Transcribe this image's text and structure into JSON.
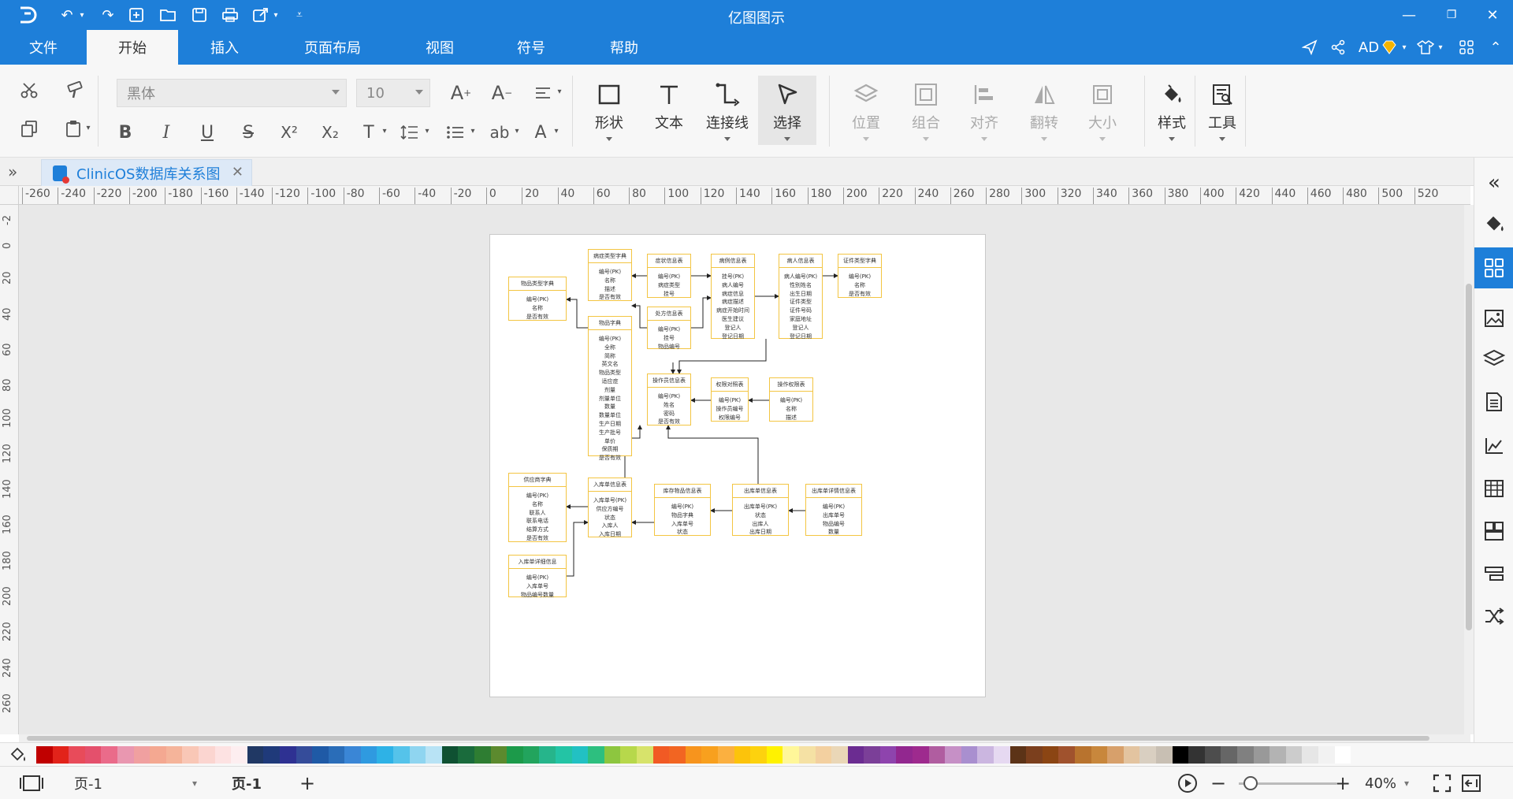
{
  "app": {
    "title": "亿图图示",
    "logo": "edraw-logo"
  },
  "quick_access": [
    "undo-icon",
    "redo-icon",
    "new-icon",
    "open-icon",
    "save-icon",
    "print-icon",
    "export-icon",
    "customize-icon"
  ],
  "menu": {
    "tabs": [
      "文件",
      "开始",
      "插入",
      "页面布局",
      "视图",
      "符号",
      "帮助"
    ],
    "active": "开始",
    "right": {
      "user": "AD"
    }
  },
  "ribbon": {
    "font_family": "黑体",
    "font_size": "10",
    "tools": {
      "shape": "形状",
      "text": "文本",
      "connector": "连接线",
      "select": "选择",
      "position": "位置",
      "group": "组合",
      "align": "对齐",
      "flip": "翻转",
      "size": "大小",
      "style": "样式",
      "tools": "工具"
    },
    "format_labels": {
      "bold": "B",
      "italic": "I",
      "underline": "U",
      "strike": "S",
      "superscript": "X²",
      "subscript": "X₂",
      "text": "T",
      "ab": "ab",
      "fontcolor": "A"
    }
  },
  "document": {
    "tab_name": "ClinicOS数据库关系图"
  },
  "rulers": {
    "h": [
      "-260",
      "-240",
      "-220",
      "-200",
      "-180",
      "-160",
      "-140",
      "-120",
      "-100",
      "-80",
      "-60",
      "-40",
      "-20",
      "0",
      "20",
      "40",
      "60",
      "80",
      "100",
      "120",
      "140",
      "160",
      "180",
      "200",
      "220",
      "240",
      "260",
      "280",
      "300",
      "320",
      "340",
      "360",
      "380",
      "400",
      "420",
      "440",
      "460",
      "480",
      "500",
      "520"
    ],
    "v": [
      "-2",
      "0",
      "20",
      "40",
      "60",
      "80",
      "100",
      "120",
      "140",
      "160",
      "180",
      "200",
      "220",
      "240",
      "260"
    ]
  },
  "diagram": {
    "entities": [
      {
        "title": "物品类型字典",
        "fields": [
          "编号(PK)",
          "名称",
          "是否有效"
        ]
      },
      {
        "title": "病症类型字典",
        "fields": [
          "编号(PK)",
          "名称",
          "描述",
          "是否有效"
        ]
      },
      {
        "title": "症状信息表",
        "fields": [
          "编号(PK)",
          "病症类型",
          "挂号"
        ]
      },
      {
        "title": "病例信息表",
        "fields": [
          "挂号(PK)",
          "病人编号",
          "病症信息",
          "病症描述",
          "病症开始时间",
          "医生建议",
          "登记人",
          "登记日期"
        ]
      },
      {
        "title": "病人信息表",
        "fields": [
          "病人编号(PK)",
          "性别姓名",
          "出生日期",
          "证件类型",
          "证件号码",
          "家庭地址",
          "登记人",
          "登记日期"
        ]
      },
      {
        "title": "证件类型字典",
        "fields": [
          "编号(PK)",
          "名称",
          "是否有效"
        ]
      },
      {
        "title": "处方信息表",
        "fields": [
          "编号(PK)",
          "挂号",
          "物品编号"
        ]
      },
      {
        "title": "物品字典",
        "fields": [
          "编号(PK)",
          "全称",
          "简称",
          "英文名",
          "物品类型",
          "适应症",
          "剂量",
          "剂量单位",
          "数量",
          "数量单位",
          "生产日期",
          "生产批号",
          "单价",
          "保质期",
          "是否有效"
        ]
      },
      {
        "title": "操作员信息表",
        "fields": [
          "编号(PK)",
          "姓名",
          "密码",
          "是否有效"
        ]
      },
      {
        "title": "权限对照表",
        "fields": [
          "编号(PK)",
          "操作员编号",
          "权限编号"
        ]
      },
      {
        "title": "操作权限表",
        "fields": [
          "编号(PK)",
          "名称",
          "描述"
        ]
      },
      {
        "title": "供应商字典",
        "fields": [
          "编号(PK)",
          "名称",
          "联系人",
          "联系电话",
          "结算方式",
          "是否有效"
        ]
      },
      {
        "title": "入库单信息表",
        "fields": [
          "入库单号(PK)",
          "供应方编号",
          "状态",
          "入库人",
          "入库日期"
        ]
      },
      {
        "title": "库存物品信息表",
        "fields": [
          "编号(PK)",
          "物品字典",
          "入库单号",
          "状态"
        ]
      },
      {
        "title": "出库单信息表",
        "fields": [
          "出库单号(PK)",
          "状态",
          "出库人",
          "出库日期"
        ]
      },
      {
        "title": "出库单详情信息表",
        "fields": [
          "编号(PK)",
          "出库单号",
          "物品编号",
          "数量"
        ]
      },
      {
        "title": "入库单详细信息",
        "fields": [
          "编号(PK)",
          "入库单号",
          "物品编号数量"
        ]
      }
    ]
  },
  "palette": {
    "colors": [
      "#c00000",
      "#e2231a",
      "#e84b5a",
      "#e4506c",
      "#ea6b8a",
      "#e997b0",
      "#f0a0a0",
      "#f4a891",
      "#f5b49a",
      "#f9c7b6",
      "#fbd5d0",
      "#fde2e2",
      "#fdeef0",
      "#203864",
      "#1f3a7a",
      "#2e3192",
      "#354c9a",
      "#1f5aa6",
      "#2a6db8",
      "#3a86d6",
      "#2f9ae0",
      "#2eb2e6",
      "#55c3ea",
      "#8fd5f0",
      "#b8e3f5",
      "#0f5132",
      "#1a6b3c",
      "#2e7d32",
      "#5c8a2e",
      "#1c9a4a",
      "#22a45d",
      "#26b58b",
      "#23c4a5",
      "#22c1c3",
      "#2dbf7f",
      "#8dc63f",
      "#b7d84b",
      "#d7e36b",
      "#f15a24",
      "#f26522",
      "#f7941d",
      "#f8a01e",
      "#fbb040",
      "#fcc30b",
      "#fdd20e",
      "#fff200",
      "#fff799",
      "#f5e1a4",
      "#f3d0a0",
      "#ead7b7",
      "#6b2c91",
      "#7b3f98",
      "#8e44ad",
      "#92278f",
      "#9e2a8e",
      "#b05da0",
      "#c690c6",
      "#a98fcf",
      "#cbb6e0",
      "#e6d9f1",
      "#5c3317",
      "#7b3f1d",
      "#8b4513",
      "#a0522d",
      "#b8732e",
      "#c8873c",
      "#d7a06b",
      "#e3c4a0",
      "#d9cfc1",
      "#c8bfb3",
      "#000000",
      "#333333",
      "#4d4d4d",
      "#666666",
      "#808080",
      "#999999",
      "#b3b3b3",
      "#cccccc",
      "#e6e6e6",
      "#f2f2f2",
      "#ffffff"
    ]
  },
  "status": {
    "page_select": "页-1",
    "page_tab": "页-1",
    "zoom": "40%",
    "zoom_level_percent": 40
  }
}
